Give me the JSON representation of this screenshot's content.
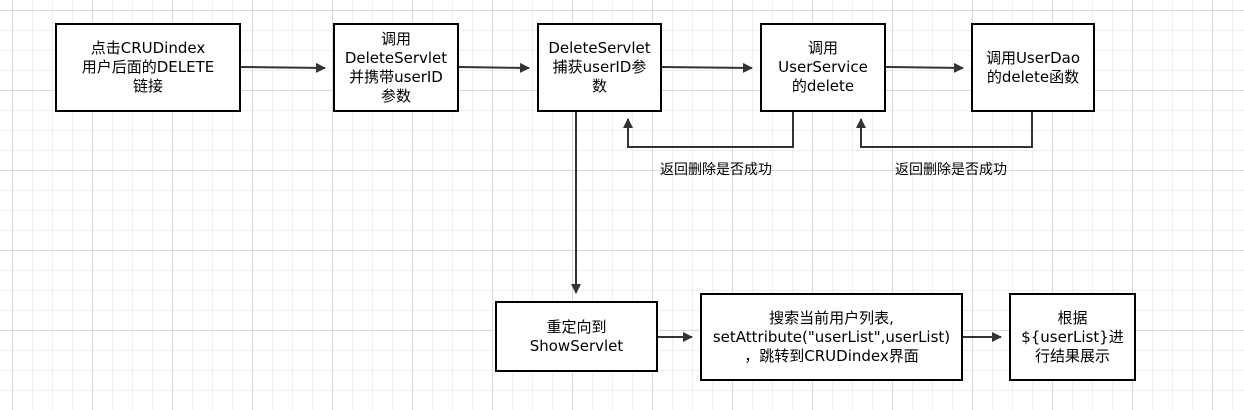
{
  "nodes": {
    "click_delete": "点击CRUDindex\n用户后面的DELETE\n链接",
    "call_delete_servlet": "调用\nDeleteServlet\n并携带userID\n参数",
    "servlet_capture": "DeleteServlet\n捕获userID参\n数",
    "call_user_service": "调用\nUserService\n的delete",
    "call_user_dao": "调用UserDao\n的delete函数",
    "redirect_show": "重定向到\nShowServlet",
    "search_users": "搜索当前用户列表,\nsetAttribute(\"userList\",userList)\n，跳转到CRUDindex界面",
    "show_result": "根据\n${userList}进\n行结果展示"
  },
  "labels": {
    "return_service": "返回删除是否成功",
    "return_dao": "返回删除是否成功"
  },
  "colors": {
    "stroke": "#333333"
  }
}
